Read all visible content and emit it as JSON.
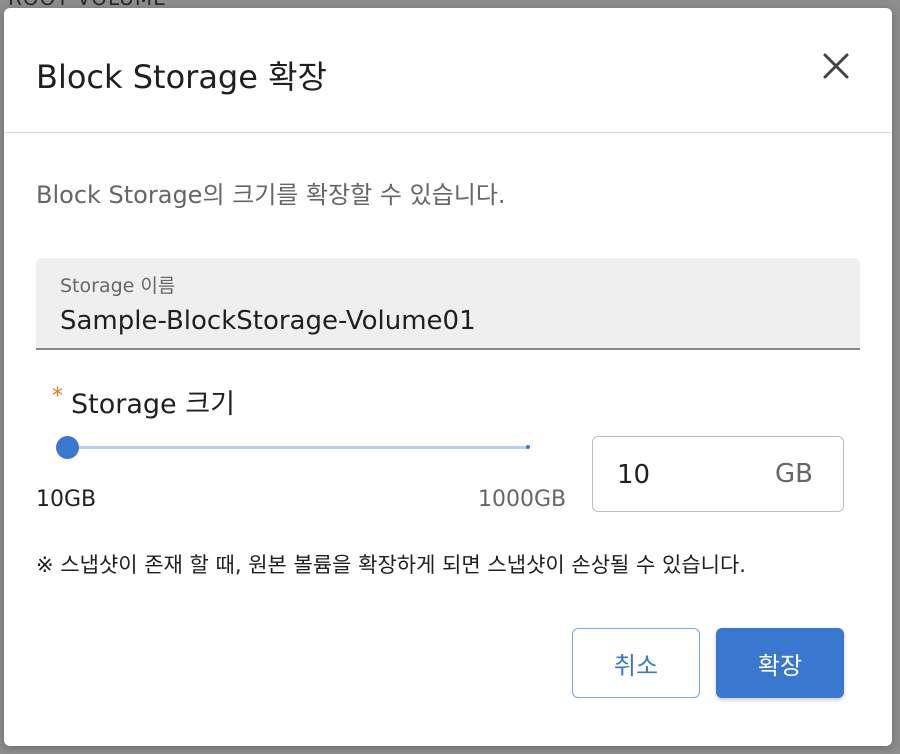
{
  "background": {
    "partial_text": "ROOT VOLUME"
  },
  "modal": {
    "title": "Block Storage 확장",
    "close_icon": "close-icon",
    "description": "Block Storage의 크기를 확장할 수 있습니다.",
    "storage_name": {
      "label": "Storage 이름",
      "value": "Sample-BlockStorage-Volume01"
    },
    "storage_size": {
      "required_mark": "*",
      "label": "Storage 크기",
      "slider_min_label": "10GB",
      "slider_max_label": "1000GB",
      "value": "10",
      "unit": "GB"
    },
    "notice": "※ 스냅샷이 존재 할 때, 원본 볼륨을 확장하게 되면 스냅샷이 손상될 수 있습니다.",
    "buttons": {
      "cancel": "취소",
      "confirm": "확장"
    }
  },
  "colors": {
    "accent": "#3a78d0",
    "required": "#e07a2b"
  }
}
